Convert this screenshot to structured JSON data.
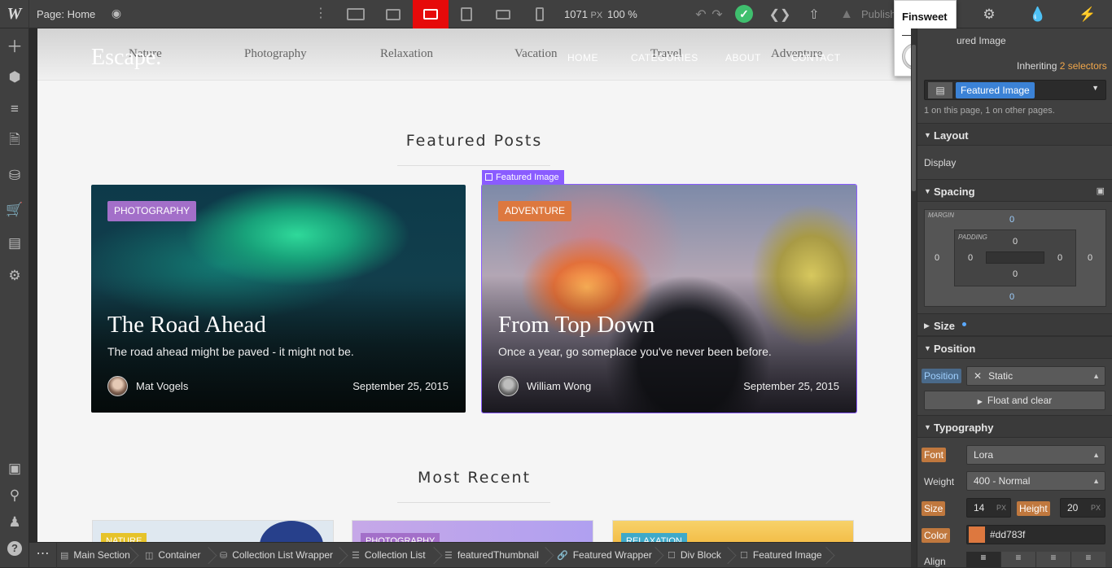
{
  "topbar": {
    "logo": "W",
    "page_label": "Page: Home",
    "width_value": "1071",
    "width_unit": "PX",
    "zoom": "100 %",
    "publish_label": "Publish"
  },
  "finsweet": {
    "title": "Finsweet",
    "toggle_on": false
  },
  "site": {
    "brand": "Escape.",
    "categories": [
      "Nature",
      "Photography",
      "Relaxation",
      "Vacation",
      "Travel",
      "Adventure"
    ],
    "nav": [
      "HOME",
      "CATEGORIES",
      "ABOUT",
      "CONTACT"
    ],
    "featured_heading": "Featured Posts",
    "recent_heading": "Most Recent",
    "selection_tag": "Featured Image",
    "featured_posts": [
      {
        "category": "PHOTOGRAPHY",
        "category_color": "#a36fc9",
        "title": "The Road Ahead",
        "description": "The road ahead might be paved - it might not be.",
        "author": "Mat Vogels",
        "date": "September 25, 2015"
      },
      {
        "category": "ADVENTURE",
        "category_color": "#dd783f",
        "title": "From Top Down",
        "description": "Once a year, go someplace you've never been before.",
        "author": "William Wong",
        "date": "September 25, 2015"
      }
    ],
    "recent_posts": [
      {
        "category": "NATURE",
        "category_color": "#e6c32a"
      },
      {
        "category": "PHOTOGRAPHY",
        "category_color": "#a36fc9"
      },
      {
        "category": "RELAXATION",
        "category_color": "#3fa9c9"
      }
    ]
  },
  "breadcrumb": [
    "Main Section",
    "Container",
    "Collection List Wrapper",
    "Collection List",
    "featuredThumbnail",
    "Featured Wrapper",
    "Div Block",
    "Featured Image"
  ],
  "panel": {
    "element_name": "ured Image",
    "inheriting_prefix": "Inheriting",
    "inheriting_link": "2 selectors",
    "selector": "Featured Image",
    "selector_count": "1 on this page, 1 on other pages.",
    "layout_title": "Layout",
    "display_label": "Display",
    "spacing_title": "Spacing",
    "margin_label": "MARGIN",
    "padding_label": "PADDING",
    "margin": {
      "top": "0",
      "right": "0",
      "bottom": "0",
      "left": "0"
    },
    "padding": {
      "top": "0",
      "right": "0",
      "bottom": "0",
      "left": "0"
    },
    "size_title": "Size",
    "position_title": "Position",
    "position_label": "Position",
    "position_value": "Static",
    "float_clear": "Float and clear",
    "typography_title": "Typography",
    "font_label": "Font",
    "font_value": "Lora",
    "weight_label": "Weight",
    "weight_value": "400 - Normal",
    "size_label": "Size",
    "size_value": "14",
    "size_unit": "PX",
    "height_label": "Height",
    "height_value": "20",
    "height_unit": "PX",
    "color_label": "Color",
    "color_value": "#dd783f",
    "align_label": "Align"
  }
}
